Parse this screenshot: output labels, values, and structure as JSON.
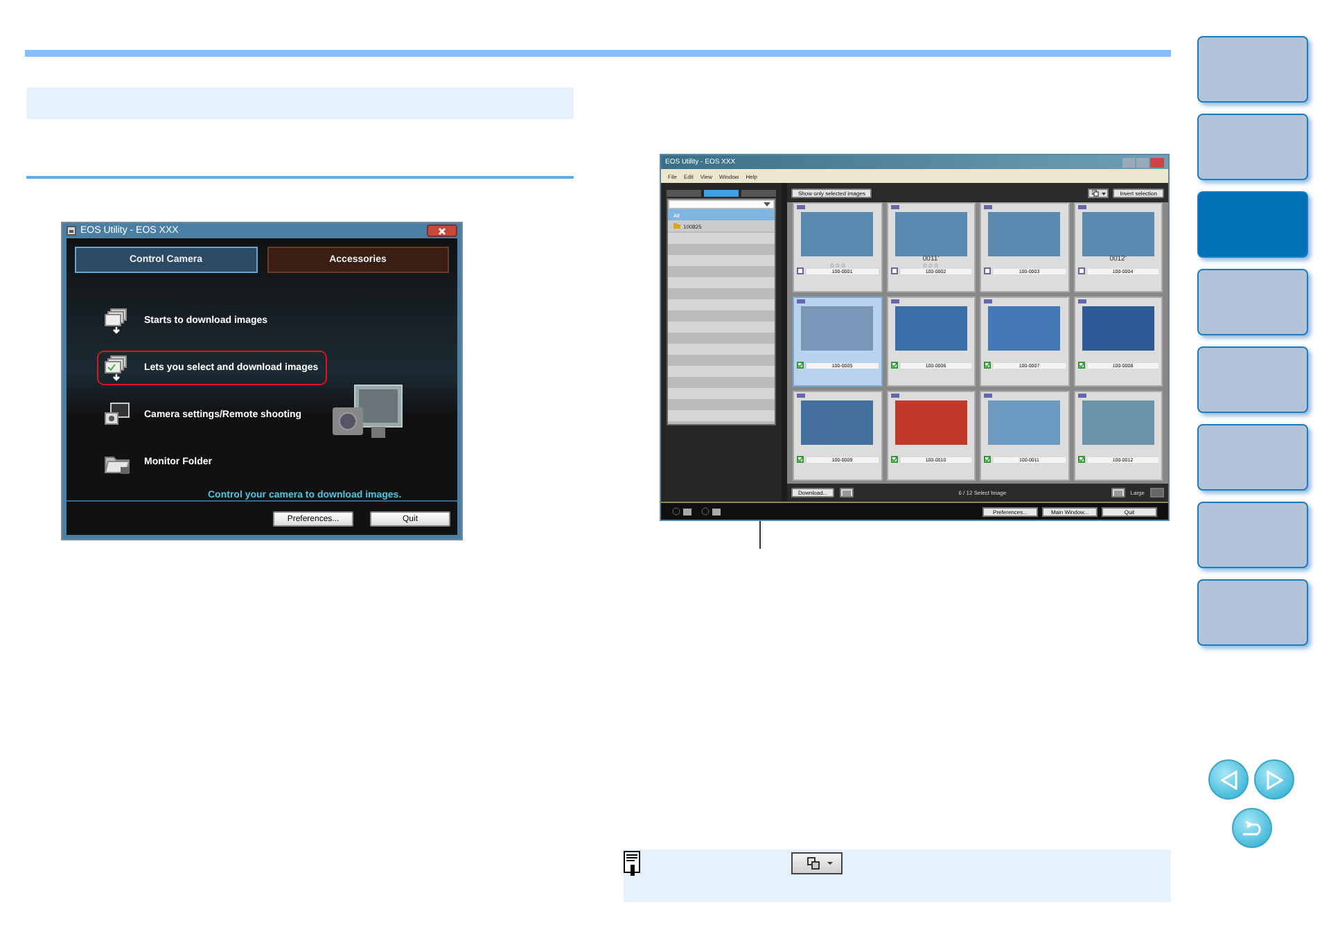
{
  "left_window": {
    "title": "EOS Utility - EOS XXX",
    "tabs": [
      {
        "label": "Control Camera",
        "selected": true
      },
      {
        "label": "Accessories",
        "selected": false
      }
    ],
    "items": [
      {
        "kind": "download",
        "label": "Starts to download images",
        "highlighted": false
      },
      {
        "kind": "select",
        "label": "Lets you select and download images",
        "highlighted": true
      },
      {
        "kind": "camera",
        "label": "Camera settings/Remote shooting",
        "highlighted": false
      },
      {
        "kind": "folder",
        "label": "Monitor Folder",
        "highlighted": false
      }
    ],
    "caption": "Control your camera to download images.",
    "buttons": [
      "Preferences...",
      "Quit"
    ]
  },
  "right_window": {
    "title": "EOS Utility - EOS XXX",
    "menu": [
      "File",
      "Edit",
      "View",
      "Window",
      "Help"
    ],
    "view_tabs": [
      {
        "selected": false
      },
      {
        "selected": true
      },
      {
        "selected": false
      }
    ],
    "show_selected_button": "Show only selected images",
    "invert_button": "Invert selection",
    "folders": [
      {
        "label": "All",
        "selected": true
      },
      {
        "label": "100825",
        "selected": false
      }
    ],
    "thumbnails": [
      {
        "name": "100-0001",
        "checked": false,
        "selected": false,
        "stars": 0
      },
      {
        "name": "100-0002",
        "checked": false,
        "selected": false,
        "stars": 0,
        "caption": "0011'"
      },
      {
        "name": "100-0003",
        "checked": false,
        "selected": false
      },
      {
        "name": "100-0004",
        "checked": false,
        "selected": false,
        "caption": "0012'"
      },
      {
        "name": "100-0005",
        "checked": true,
        "selected": true
      },
      {
        "name": "100-0006",
        "checked": true,
        "selected": false
      },
      {
        "name": "100-0007",
        "checked": true,
        "selected": false
      },
      {
        "name": "100-0008",
        "checked": true,
        "selected": false
      },
      {
        "name": "100-0009",
        "checked": true,
        "selected": false
      },
      {
        "name": "100-0010",
        "checked": true,
        "selected": false
      },
      {
        "name": "100-0011",
        "checked": true,
        "selected": false
      },
      {
        "name": "100-0012",
        "checked": true,
        "selected": false
      }
    ],
    "download_button": "Download...",
    "status": "6 / 12 Select Image",
    "size_label": "Large",
    "footer_buttons": [
      "Preferences...",
      "Main Window...",
      "Quit"
    ]
  },
  "nav_tabs": [
    {
      "selected": false
    },
    {
      "selected": false
    },
    {
      "selected": true
    },
    {
      "selected": false
    },
    {
      "selected": false
    },
    {
      "selected": false
    },
    {
      "selected": false
    },
    {
      "selected": false
    }
  ]
}
